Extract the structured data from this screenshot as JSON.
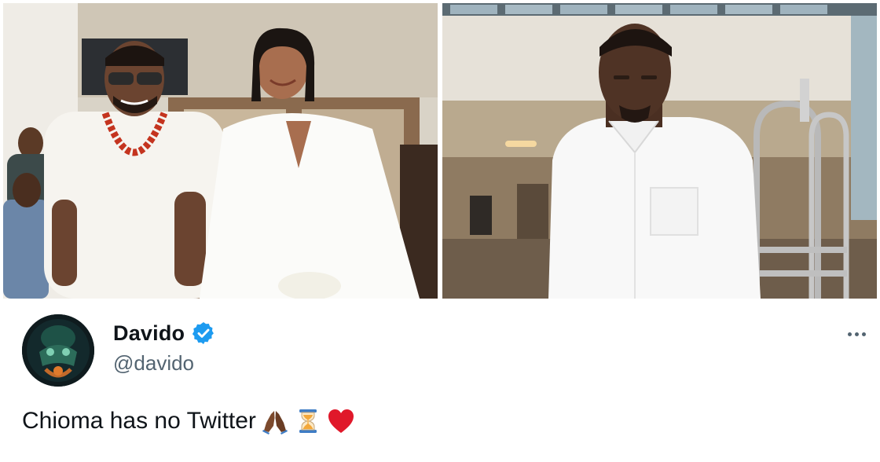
{
  "tweet": {
    "display_name": "Davido",
    "handle": "@davido",
    "text": "Chioma has no Twitter",
    "emojis": [
      "folded-hands-icon",
      "hourglass-icon",
      "red-heart-icon"
    ],
    "verified": true,
    "colors": {
      "name": "#0f1419",
      "handle": "#536471",
      "verified": "#1d9bf0",
      "heart": "#e0182a"
    }
  },
  "photos": [
    {
      "name": "photo-couple-wedding"
    },
    {
      "name": "photo-man-white-shirt"
    }
  ]
}
